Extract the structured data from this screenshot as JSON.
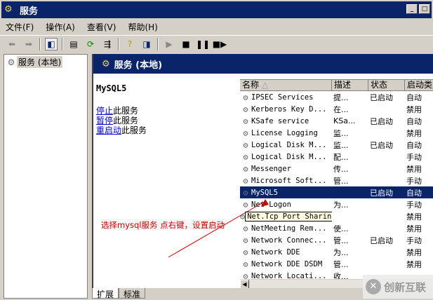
{
  "window": {
    "title": "服务"
  },
  "menu": [
    "文件(F)",
    "操作(A)",
    "查看(V)",
    "帮助(H)"
  ],
  "tree": {
    "item": "服务 (本地)"
  },
  "header": {
    "title": "服务 (本地)"
  },
  "extended": {
    "service": "MySQL5",
    "actions": [
      {
        "link": "停止",
        "text": "此服务"
      },
      {
        "link": "暂停",
        "text": "此服务"
      },
      {
        "link": "重启动",
        "text": "此服务"
      }
    ]
  },
  "columns": [
    "名称",
    "描述",
    "状态",
    "启动类型"
  ],
  "rows": [
    {
      "name": "IPSEC Services",
      "desc": "提...",
      "status": "已启动",
      "startup": "自动"
    },
    {
      "name": "Kerberos Key D...",
      "desc": "在...",
      "status": "",
      "startup": "禁用"
    },
    {
      "name": "KSafe service",
      "desc": "KSa...",
      "status": "已启动",
      "startup": "自动"
    },
    {
      "name": "License Logging",
      "desc": "监...",
      "status": "",
      "startup": "禁用"
    },
    {
      "name": "Logical Disk M...",
      "desc": "监...",
      "status": "已启动",
      "startup": "自动"
    },
    {
      "name": "Logical Disk M...",
      "desc": "配...",
      "status": "",
      "startup": "手动"
    },
    {
      "name": "Messenger",
      "desc": "传...",
      "status": "",
      "startup": "禁用"
    },
    {
      "name": "Microsoft Soft...",
      "desc": "管...",
      "status": "",
      "startup": "手动"
    },
    {
      "name": "MySQL5",
      "desc": "",
      "status": "已启动",
      "startup": "自动"
    },
    {
      "name": "Net Logon",
      "desc": "为...",
      "status": "",
      "startup": "手动"
    },
    {
      "name": "Net.Tcp Port Sharing Service",
      "desc": "",
      "status": "",
      "startup": "禁用"
    },
    {
      "name": "NetMeeting Rem...",
      "desc": "使...",
      "status": "",
      "startup": "禁用"
    },
    {
      "name": "Network Connec...",
      "desc": "管...",
      "status": "已启动",
      "startup": "手动"
    },
    {
      "name": "Network DDE",
      "desc": "为...",
      "status": "",
      "startup": "禁用"
    },
    {
      "name": "Network DDE DSDM",
      "desc": "管...",
      "status": "",
      "startup": "禁用"
    },
    {
      "name": "Network Locati...",
      "desc": "收...",
      "status": "",
      "startup": ""
    }
  ],
  "tabs": [
    "扩展",
    "标准"
  ],
  "annotation": "选择mysql服务 点右键，设置启动",
  "watermark": "创新互联"
}
